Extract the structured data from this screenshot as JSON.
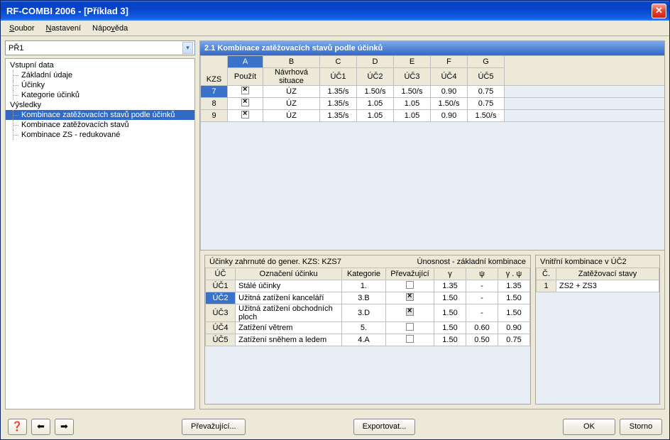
{
  "title": "RF-COMBI 2006 - [Příklad 3]",
  "menubar": [
    "Soubor",
    "Nastavení",
    "Nápověda"
  ],
  "combo": "PŘ1",
  "tree": {
    "group1": "Vstupní data",
    "items1": [
      "Základní údaje",
      "Účinky",
      "Kategorie účinků"
    ],
    "group2": "Výsledky",
    "items2": [
      "Kombinace zatěžovacích stavů podle účinků",
      "Kombinace zatěžovacích stavů",
      "Kombinace ZS - redukované"
    ]
  },
  "section_title": "2.1 Kombinace zatěžovacích stavů podle účinků",
  "grid1": {
    "letters": [
      "A",
      "B",
      "C",
      "D",
      "E",
      "F",
      "G"
    ],
    "kzs": "KZS",
    "headers": [
      "Použít",
      "Návrhová situace",
      "ÚČ1",
      "ÚČ2",
      "ÚČ3",
      "ÚČ4",
      "ÚČ5"
    ],
    "rows": [
      {
        "id": "7",
        "sit": "ÚZ",
        "v": [
          "1.35/s",
          "1.50/s",
          "1.50/s",
          "0.90",
          "0.75"
        ],
        "sel": true
      },
      {
        "id": "8",
        "sit": "ÚZ",
        "v": [
          "1.35/s",
          "1.05",
          "1.05",
          "1.50/s",
          "0.75"
        ]
      },
      {
        "id": "9",
        "sit": "ÚZ",
        "v": [
          "1.35/s",
          "1.05",
          "1.05",
          "0.90",
          "1.50/s"
        ]
      }
    ]
  },
  "panel2": {
    "title_l": "Účinky zahrnuté do gener. KZS: KZS7",
    "title_r": "Únosnost - základní kombinace",
    "headers": [
      "ÚČ",
      "Označení účinku",
      "Kategorie",
      "Převažující",
      "γ",
      "ψ",
      "γ . ψ"
    ],
    "rows": [
      {
        "uc": "ÚČ1",
        "name": "Stálé účinky",
        "kat": "1.",
        "pv": false,
        "g": "1.35",
        "p": "-",
        "gp": "1.35"
      },
      {
        "uc": "ÚČ2",
        "name": "Užitná zatížení kanceláří",
        "kat": "3.B",
        "pv": true,
        "pvg": true,
        "g": "1.50",
        "p": "-",
        "gp": "1.50",
        "sel": true
      },
      {
        "uc": "ÚČ3",
        "name": "Užitná zatížení obchodních ploch",
        "kat": "3.D",
        "pv": true,
        "pvg": true,
        "g": "1.50",
        "p": "-",
        "gp": "1.50"
      },
      {
        "uc": "ÚČ4",
        "name": "Zatížení větrem",
        "kat": "5.",
        "pv": false,
        "g": "1.50",
        "p": "0.60",
        "gp": "0.90"
      },
      {
        "uc": "ÚČ5",
        "name": "Zatížení sněhem a ledem",
        "kat": "4.A",
        "pv": false,
        "g": "1.50",
        "p": "0.50",
        "gp": "0.75"
      }
    ]
  },
  "panel3": {
    "title": "Vnitřní kombinace v ÚČ2",
    "headers": [
      "Č.",
      "Zatěžovací stavy"
    ],
    "rows": [
      {
        "n": "1",
        "s": "ZS2 + ZS3"
      }
    ]
  },
  "buttons": {
    "prev": "Převažující...",
    "export": "Exportovat...",
    "ok": "OK",
    "storno": "Storno"
  }
}
